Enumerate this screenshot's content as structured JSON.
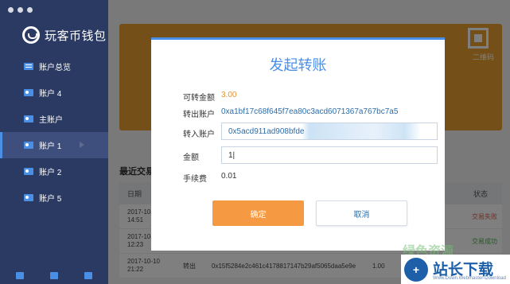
{
  "app": {
    "logo_text": "玩客币钱包"
  },
  "sidebar": {
    "items": [
      {
        "label": "账户总览",
        "icon": "overview-icon"
      },
      {
        "label": "账户 4",
        "icon": "account-card-icon"
      },
      {
        "label": "主账户",
        "icon": "account-card-icon"
      },
      {
        "label": "账户 1",
        "icon": "account-card-icon",
        "active": true
      },
      {
        "label": "账户 2",
        "icon": "account-card-icon"
      },
      {
        "label": "账户 5",
        "icon": "account-card-icon"
      }
    ],
    "footer_icons": [
      "home-icon",
      "wallet-icon",
      "settings-icon"
    ]
  },
  "main": {
    "qr_label": "二维码",
    "recent_title": "最近交易",
    "table": {
      "headers": {
        "date": "日期",
        "status": "状态"
      },
      "rows": [
        {
          "date": "2017-10-\n14:51",
          "type": "",
          "address": "",
          "amount": "",
          "status": "交易失败"
        },
        {
          "date": "2017-10-\n12:23",
          "type": "",
          "address": "",
          "amount": "",
          "status": "交易成功"
        },
        {
          "date": "2017-10-10\n21:22",
          "type": "转出",
          "address": "0x15f5284e2c461c4178817147b29af5065daa5e9e",
          "amount": "1.00",
          "status": ""
        }
      ]
    }
  },
  "modal": {
    "title": "发起转账",
    "available_label": "可转金额",
    "available_value": "3.00",
    "from_label": "转出账户",
    "from_value": "0xa1bf17c68f645f7ea80c3acd6071367a767bc7a5",
    "to_label": "转入账户",
    "to_value": "0x5acd911ad908bfde",
    "amount_label": "金额",
    "amount_value": "1|",
    "fee_label": "手续费",
    "fee_value": "0.01",
    "confirm_label": "确定",
    "cancel_label": "取消"
  },
  "watermark": {
    "overlay_text": "绿色资源",
    "logo_glyph": "+",
    "name": "站长下载",
    "url": "Www.Down.Webmaster-Download"
  },
  "colors": {
    "sidebar": "#2b3a63",
    "accent": "#4a8fe6",
    "orange": "#f59a42",
    "banner": "#e8a031"
  }
}
